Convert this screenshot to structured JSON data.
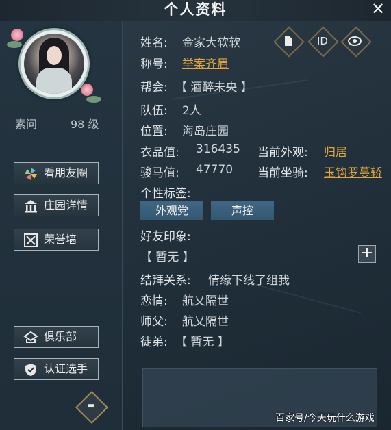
{
  "window": {
    "title": "个人资料",
    "close_glyph": "✕"
  },
  "character": {
    "name": "素问",
    "level": "98 级"
  },
  "sidebar": {
    "buttons": [
      {
        "label": "看朋友圈",
        "icon": "pinwheel-icon"
      },
      {
        "label": "庄园详情",
        "icon": "manor-icon"
      },
      {
        "label": "荣誉墙",
        "icon": "honor-wall-icon"
      },
      {
        "label": "俱乐部",
        "icon": "club-icon"
      },
      {
        "label": "认证选手",
        "icon": "verified-shield-icon"
      }
    ],
    "chat_icon": "chat-bubble-icon"
  },
  "profile": {
    "name_label": "姓名:",
    "name_value": "金家大软软",
    "title_label": "称号:",
    "title_value": "举案齐眉",
    "guild_label": "帮会:",
    "guild_value": "【 酒醉未央 】",
    "team_label": "队伍:",
    "team_value": "2人",
    "location_label": "位置:",
    "location_value": "海岛庄园",
    "outfit_label": "衣品值:",
    "outfit_value": "316435",
    "appearance_label": "当前外观:",
    "appearance_value": "归居",
    "mount_label": "骏马值:",
    "mount_value": "47770",
    "current_mount_label": "当前坐骑:",
    "current_mount_value": "玉钩罗蔓轿",
    "tags_label": "个性标签:",
    "tags": [
      "外观党",
      "声控"
    ],
    "impression_label": "好友印象:",
    "impression_value": "【 暂无 】",
    "sworn_label": "结拜关系:",
    "sworn_value": "情缘下线了组我",
    "romance_label": "恋情:",
    "romance_value": "航乂隔世",
    "master_label": "师父:",
    "master_value": "航乂隔世",
    "apprentice_label": "徒弟:",
    "apprentice_value": "【 暂无 】"
  },
  "icon_buttons": {
    "copy_icon": "copy-icon",
    "id_text": "ID",
    "eye_icon": "eye-icon"
  },
  "add_glyph": "+",
  "watermark": "百家号/今天玩什么游戏",
  "colors": {
    "link": "#e2a43c",
    "tag_bg": "#3f6784",
    "background": "#22313c"
  }
}
